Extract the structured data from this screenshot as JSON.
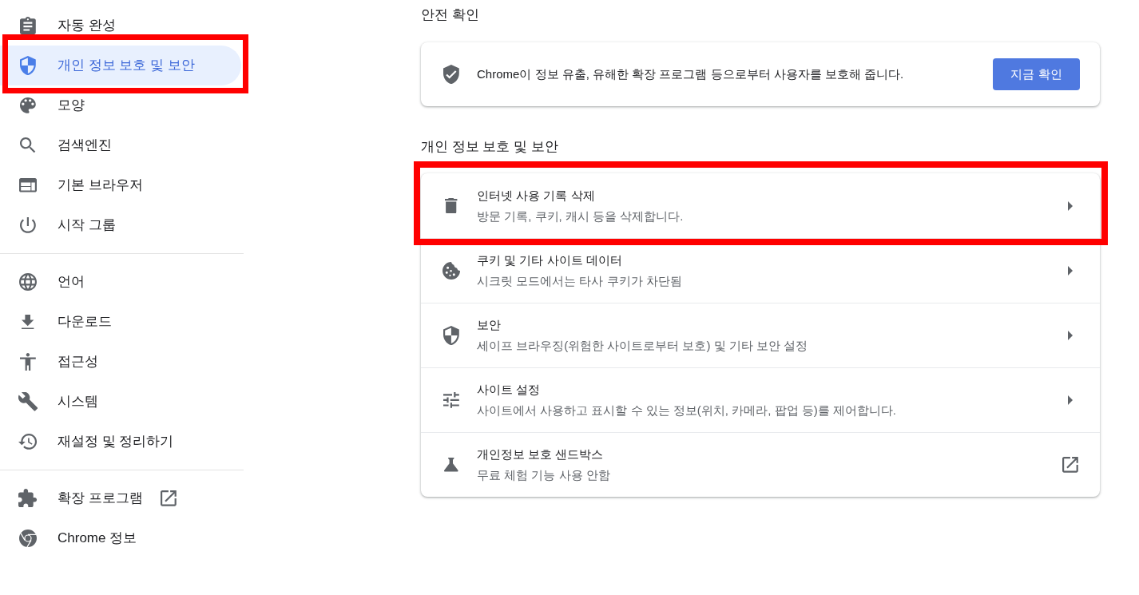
{
  "sidebar": {
    "groups": [
      {
        "items": [
          {
            "label": "자동 완성",
            "selected": false,
            "highlighted": false,
            "external": false
          },
          {
            "label": "개인 정보 보호 및 보안",
            "selected": true,
            "highlighted": true,
            "external": false
          },
          {
            "label": "모양",
            "selected": false,
            "highlighted": false,
            "external": false
          },
          {
            "label": "검색엔진",
            "selected": false,
            "highlighted": false,
            "external": false
          },
          {
            "label": "기본 브라우저",
            "selected": false,
            "highlighted": false,
            "external": false
          },
          {
            "label": "시작 그룹",
            "selected": false,
            "highlighted": false,
            "external": false
          }
        ]
      },
      {
        "items": [
          {
            "label": "언어",
            "selected": false,
            "highlighted": false,
            "external": false
          },
          {
            "label": "다운로드",
            "selected": false,
            "highlighted": false,
            "external": false
          },
          {
            "label": "접근성",
            "selected": false,
            "highlighted": false,
            "external": false
          },
          {
            "label": "시스템",
            "selected": false,
            "highlighted": false,
            "external": false
          },
          {
            "label": "재설정 및 정리하기",
            "selected": false,
            "highlighted": false,
            "external": false
          }
        ]
      },
      {
        "items": [
          {
            "label": "확장 프로그램",
            "selected": false,
            "highlighted": false,
            "external": true
          },
          {
            "label": "Chrome 정보",
            "selected": false,
            "highlighted": false,
            "external": false
          }
        ]
      }
    ]
  },
  "safety_check": {
    "heading": "안전 확인",
    "text": "Chrome이 정보 유출, 유해한 확장 프로그램 등으로부터 사용자를 보호해 줍니다.",
    "button": "지금 확인"
  },
  "privacy": {
    "heading": "개인 정보 보호 및 보안",
    "rows": [
      {
        "kind": "subpage",
        "title": "인터넷 사용 기록 삭제",
        "subtitle": "방문 기록, 쿠키, 캐시 등을 삭제합니다.",
        "highlighted": true
      },
      {
        "kind": "subpage",
        "title": "쿠키 및 기타 사이트 데이터",
        "subtitle": "시크릿 모드에서는 타사 쿠키가 차단됨",
        "highlighted": false
      },
      {
        "kind": "subpage",
        "title": "보안",
        "subtitle": "세이프 브라우징(위험한 사이트로부터 보호) 및 기타 보안 설정",
        "highlighted": false
      },
      {
        "kind": "subpage",
        "title": "사이트 설정",
        "subtitle": "사이트에서 사용하고 표시할 수 있는 정보(위치, 카메라, 팝업 등)를 제어합니다.",
        "highlighted": false
      },
      {
        "kind": "external",
        "title": "개인정보 보호 샌드박스",
        "subtitle": "무료 체험 기능 사용 안함",
        "highlighted": false
      }
    ]
  }
}
